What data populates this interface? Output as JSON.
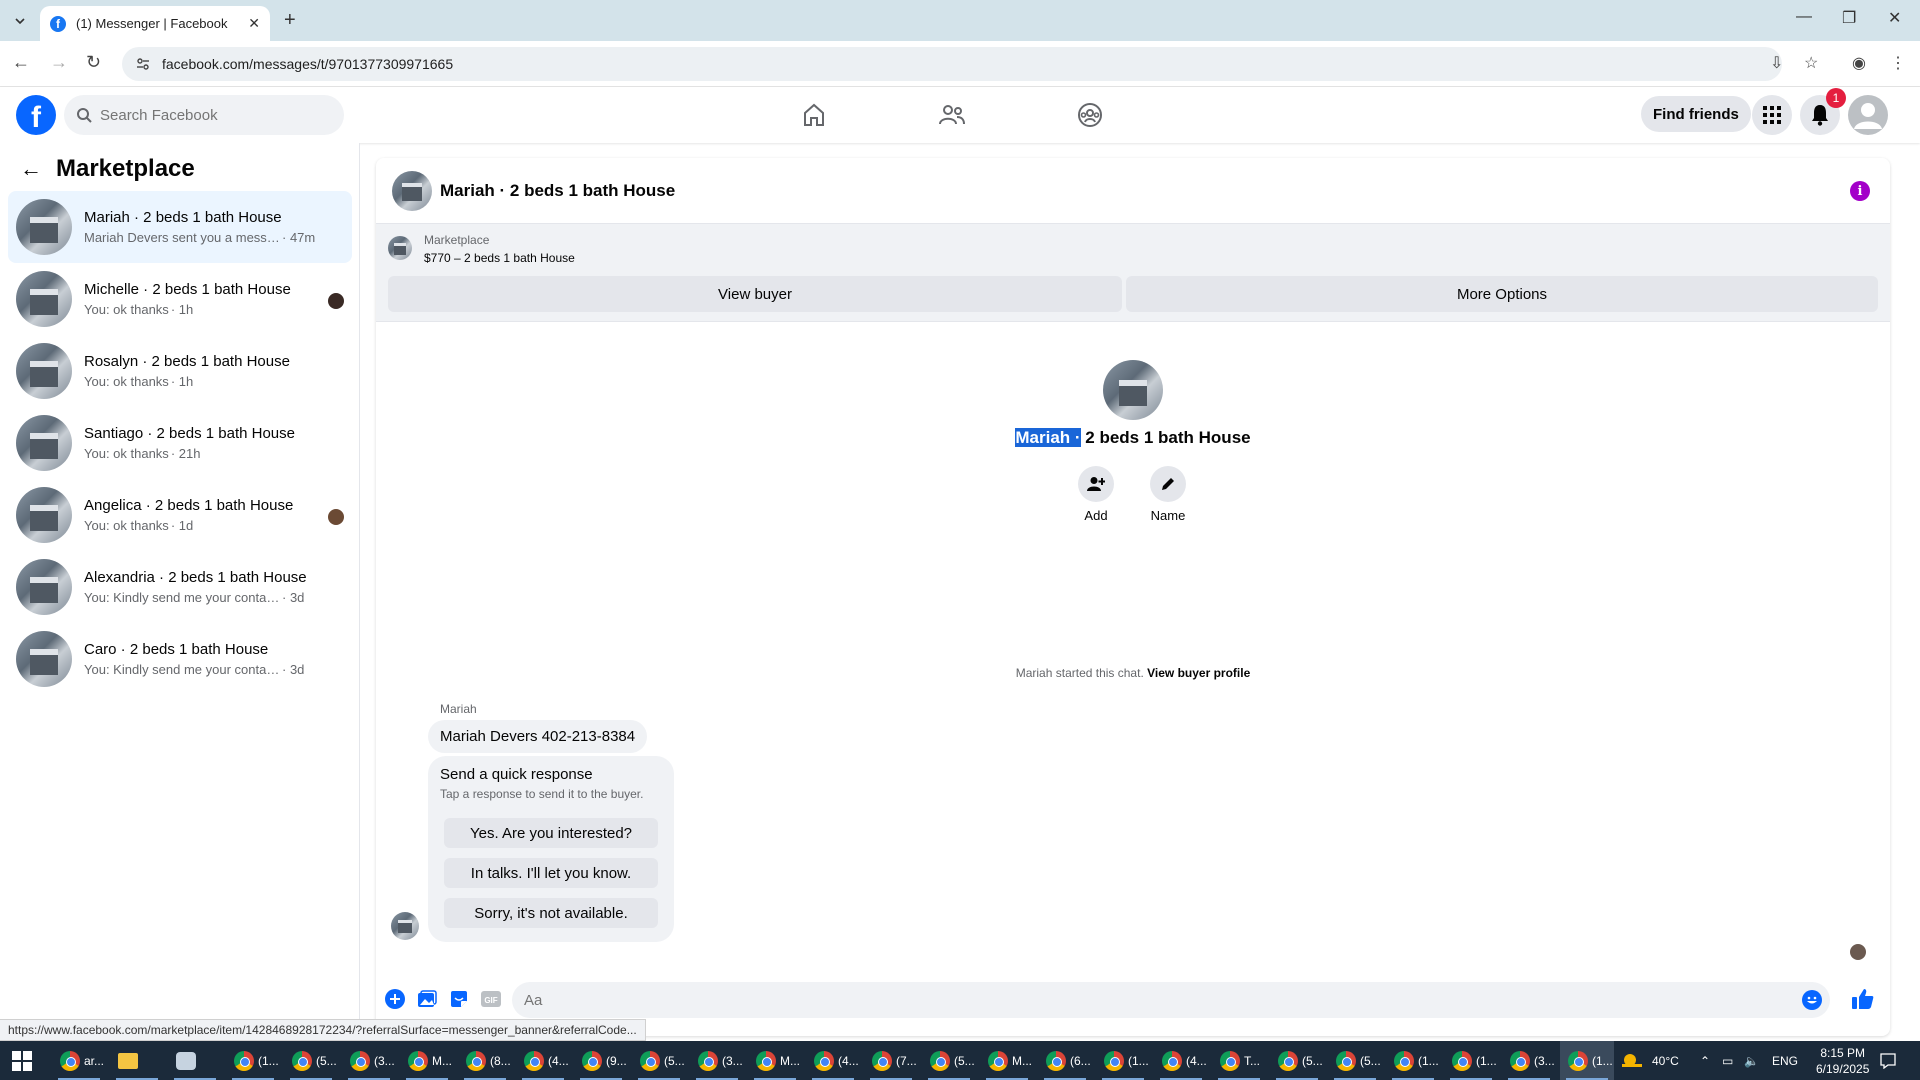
{
  "browser": {
    "tab_title": "(1) Messenger | Facebook",
    "url": "facebook.com/messages/t/9701377309971665"
  },
  "header": {
    "search_placeholder": "Search Facebook",
    "find_friends": "Find friends",
    "notification_count": "1"
  },
  "sidebar": {
    "title": "Marketplace",
    "conversations": [
      {
        "name": "Mariah · 2 beds 1 bath House",
        "snippet": "Mariah Devers sent you a message ...",
        "time": "· 47m",
        "active": true
      },
      {
        "name": "Michelle · 2 beds 1 bath House",
        "snippet": "You: ok thanks",
        "time": "· 1h"
      },
      {
        "name": "Rosalyn · 2 beds 1 bath House",
        "snippet": "You: ok thanks",
        "time": "· 1h"
      },
      {
        "name": "Santiago · 2 beds 1 bath House",
        "snippet": "You: ok thanks",
        "time": "· 21h"
      },
      {
        "name": "Angelica · 2 beds 1 bath House",
        "snippet": "You: ok thanks",
        "time": "· 1d"
      },
      {
        "name": "Alexandria · 2 beds 1 bath House",
        "snippet": "You: Kindly send me your contact nu...",
        "time": "· 3d"
      },
      {
        "name": "Caro · 2 beds 1 bath House",
        "snippet": "You: Kindly send me your contact nu...",
        "time": "· 3d"
      }
    ]
  },
  "chat": {
    "title": "Mariah · 2 beds 1 bath House",
    "banner_label": "Marketplace",
    "banner_price": "$770 – 2 beds 1 bath House",
    "view_buyer": "View buyer",
    "more_options": "More Options",
    "center_title_selected": "Mariah ·",
    "center_title_rest": " 2 beds 1 bath House",
    "add_label": "Add",
    "name_label": "Name",
    "started_text": "Mariah started this chat.",
    "started_link": "View buyer profile",
    "sender_name": "Mariah",
    "message": "Mariah Devers 402-213-8384",
    "quick_title": "Send a quick response",
    "quick_sub": "Tap a response to send it to the buyer.",
    "quick_options": [
      "Yes. Are you interested?",
      "In talks. I'll let you know.",
      "Sorry, it's not available."
    ],
    "composer_placeholder": "Aa"
  },
  "status_url": "https://www.facebook.com/marketplace/item/1428468928172234/?referralSurface=messenger_banner&referralCode...",
  "taskbar": {
    "items": [
      "ar...",
      "",
      "",
      "(1...",
      "(5...",
      "(3...",
      "M...",
      "(8...",
      "(4...",
      "(9...",
      "(5...",
      "(3...",
      "M...",
      "(4...",
      "(7...",
      "(5...",
      "M...",
      "(6...",
      "(1...",
      "(4...",
      "T...",
      "(5...",
      "(5...",
      "(1...",
      "(1...",
      "(3...",
      "(1..."
    ],
    "temperature": "40°C",
    "language": "ENG",
    "time": "8:15 PM",
    "date": "6/19/2025"
  },
  "colors": {
    "facebook_blue": "#0866ff",
    "active_conv_bg": "#ebf5ff",
    "info_purple": "#a300c9",
    "notif_red": "#e41e3f"
  }
}
